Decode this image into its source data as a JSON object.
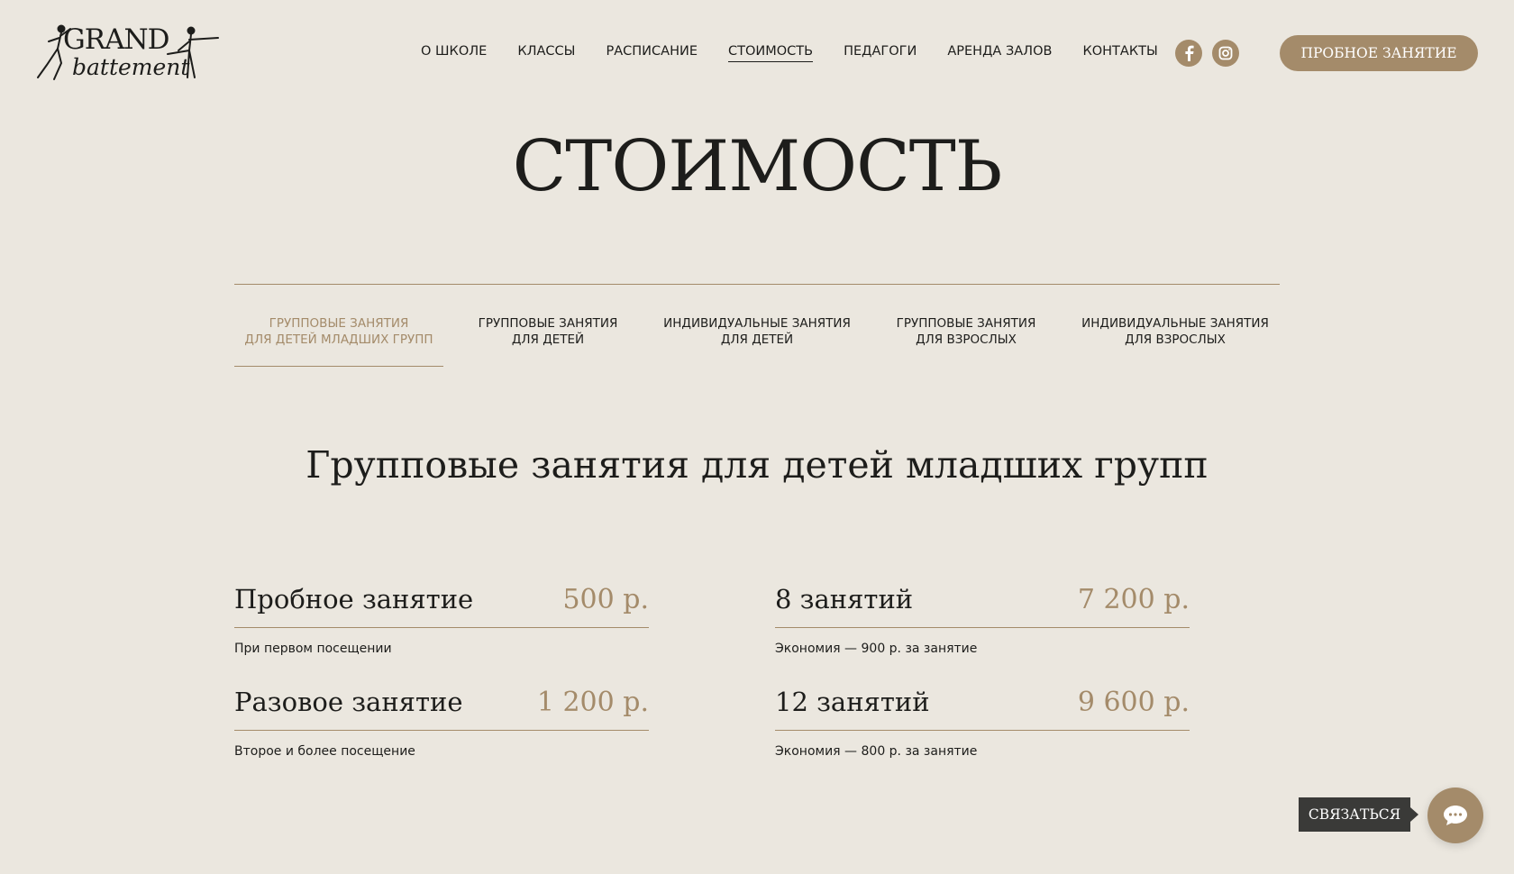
{
  "brand": {
    "logo_line1": "GRAND",
    "logo_line2": "battement"
  },
  "nav": {
    "items": [
      "О ШКОЛЕ",
      "КЛАССЫ",
      "РАСПИСАНИЕ",
      "СТОИМОСТЬ",
      "ПЕДАГОГИ",
      "АРЕНДА ЗАЛОВ",
      "КОНТАКТЫ"
    ],
    "active": "СТОИМОСТЬ"
  },
  "social": {
    "facebook_icon": "facebook-icon",
    "instagram_icon": "instagram-icon"
  },
  "header": {
    "cta_label": "ПРОБНОЕ ЗАНЯТИЕ"
  },
  "page": {
    "title": "СТОИМОСТЬ"
  },
  "tabs": [
    {
      "line1": "ГРУППОВЫЕ ЗАНЯТИЯ",
      "line2": "ДЛЯ ДЕТЕЙ МЛАДШИХ ГРУПП",
      "active": true
    },
    {
      "line1": "ГРУППОВЫЕ ЗАНЯТИЯ",
      "line2": "ДЛЯ ДЕТЕЙ",
      "active": false
    },
    {
      "line1": "ИНДИВИДУАЛЬНЫЕ ЗАНЯТИЯ",
      "line2": "ДЛЯ ДЕТЕЙ",
      "active": false
    },
    {
      "line1": "ГРУППОВЫЕ ЗАНЯТИЯ",
      "line2": "ДЛЯ ВЗРОСЛЫХ",
      "active": false
    },
    {
      "line1": "ИНДИВИДУАЛЬНЫЕ ЗАНЯТИЯ",
      "line2": "ДЛЯ ВЗРОСЛЫХ",
      "active": false
    }
  ],
  "section": {
    "title": "Групповые занятия для детей младших групп"
  },
  "prices": [
    {
      "name": "Пробное занятие",
      "value": "500 р.",
      "note": "При первом посещении"
    },
    {
      "name": "8 занятий",
      "value": "7 200 р.",
      "note": "Экономия — 900 р. за занятие"
    },
    {
      "name": "Разовое занятие",
      "value": "1 200 р.",
      "note": "Второе и более посещение"
    },
    {
      "name": "12 занятий",
      "value": "9 600 р.",
      "note": "Экономия — 800 р. за занятие"
    }
  ],
  "widget": {
    "contact_label": "СВЯЗАТЬСЯ",
    "chat_icon": "chat-icon"
  },
  "colors": {
    "background": "#ebe7df",
    "accent": "#a48b6a",
    "text": "#1d1d1b",
    "tag": "#3a3a38"
  }
}
